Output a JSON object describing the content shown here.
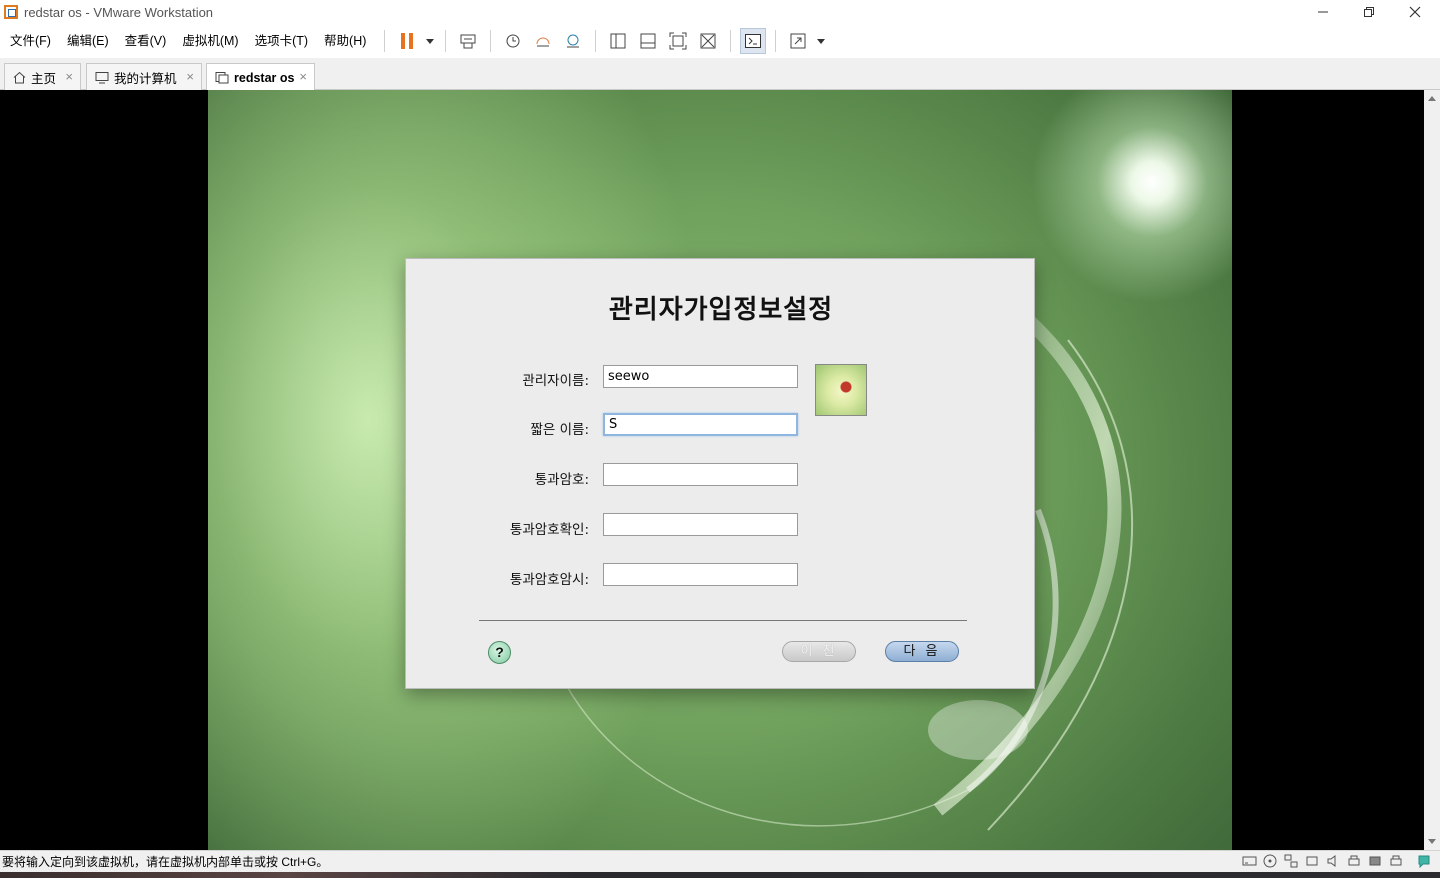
{
  "window": {
    "title": "redstar os - VMware Workstation"
  },
  "menu": {
    "items": [
      {
        "label": "文件(F)"
      },
      {
        "label": "编辑(E)"
      },
      {
        "label": "查看(V)"
      },
      {
        "label": "虚拟机(M)"
      },
      {
        "label": "选项卡(T)"
      },
      {
        "label": "帮助(H)"
      }
    ]
  },
  "toolbar": {
    "icons": [
      "pause-icon",
      "send-ctrl-alt-del-icon",
      "snapshot-take-icon",
      "snapshot-revert-icon",
      "snapshot-manager-icon",
      "show-library-icon",
      "show-thumbnail-icon",
      "fullscreen-icon",
      "unity-icon",
      "console-view-icon",
      "stretch-icon"
    ]
  },
  "tabs": [
    {
      "label": "主页",
      "icon": "home-icon",
      "active": false
    },
    {
      "label": "我的计算机",
      "icon": "computer-icon",
      "active": false
    },
    {
      "label": "redstar os",
      "icon": "vm-icon",
      "active": true
    }
  ],
  "dialog": {
    "title": "관리자가입정보설정",
    "fields": [
      {
        "label": "관리자이름:",
        "value": "seewo",
        "focused": false
      },
      {
        "label": "짧은 이름:",
        "value": "S",
        "focused": true
      },
      {
        "label": "통과암호:",
        "value": "",
        "focused": false
      },
      {
        "label": "통과암호확인:",
        "value": "",
        "focused": false
      },
      {
        "label": "통과암호암시:",
        "value": "",
        "focused": false
      }
    ],
    "help_label": "?",
    "prev_label": "이 전",
    "next_label": "다 음",
    "prev_enabled": false
  },
  "statusbar": {
    "message": "要将输入定向到该虚拟机，请在虚拟机内部单击或按 Ctrl+G。",
    "icons": [
      "hard-disk-icon",
      "cd-dvd-icon",
      "network-icon",
      "usb-icon",
      "sound-icon",
      "printer-icon",
      "display-icon",
      "message-icon"
    ]
  }
}
